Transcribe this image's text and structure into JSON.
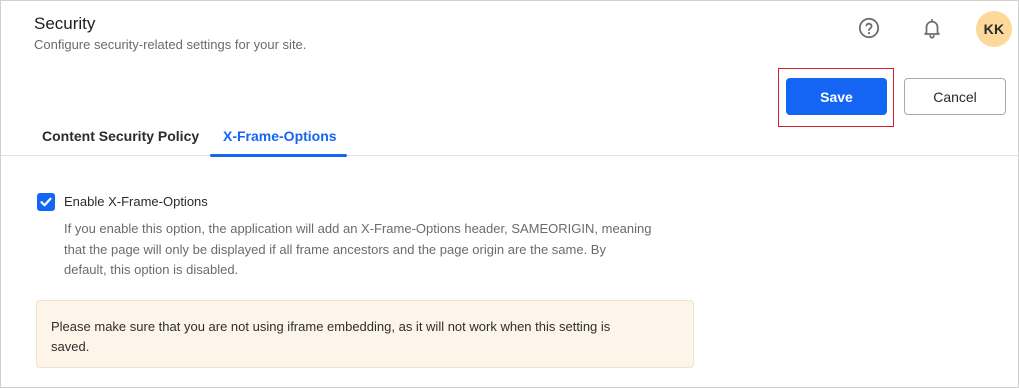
{
  "header": {
    "title": "Security",
    "subtitle": "Configure security-related settings for your site."
  },
  "topbar": {
    "help_icon": "help-circle-icon",
    "notifications_icon": "bell-icon",
    "avatar_initials": "KK",
    "avatar_color": "#fcd99b"
  },
  "actions": {
    "save_label": "Save",
    "cancel_label": "Cancel"
  },
  "tabs": [
    {
      "label": "Content Security Policy",
      "active": false
    },
    {
      "label": "X-Frame-Options",
      "active": true
    }
  ],
  "setting": {
    "checkbox_label": "Enable X-Frame-Options",
    "checked": true,
    "description_lines": [
      "If you enable this option, the application will add an X-Frame-Options header, SAMEORIGIN, meaning",
      "that the page will only be displayed if all frame ancestors and the page origin are the same. By",
      "default, this option is disabled."
    ]
  },
  "notice": {
    "lines": [
      "Please make sure that you are not using iframe embedding, as it will not work when this setting is",
      "saved."
    ]
  },
  "colors": {
    "accent": "#1565f5",
    "highlight_border": "#d0202a",
    "notice_background": "#fdf5ea"
  }
}
